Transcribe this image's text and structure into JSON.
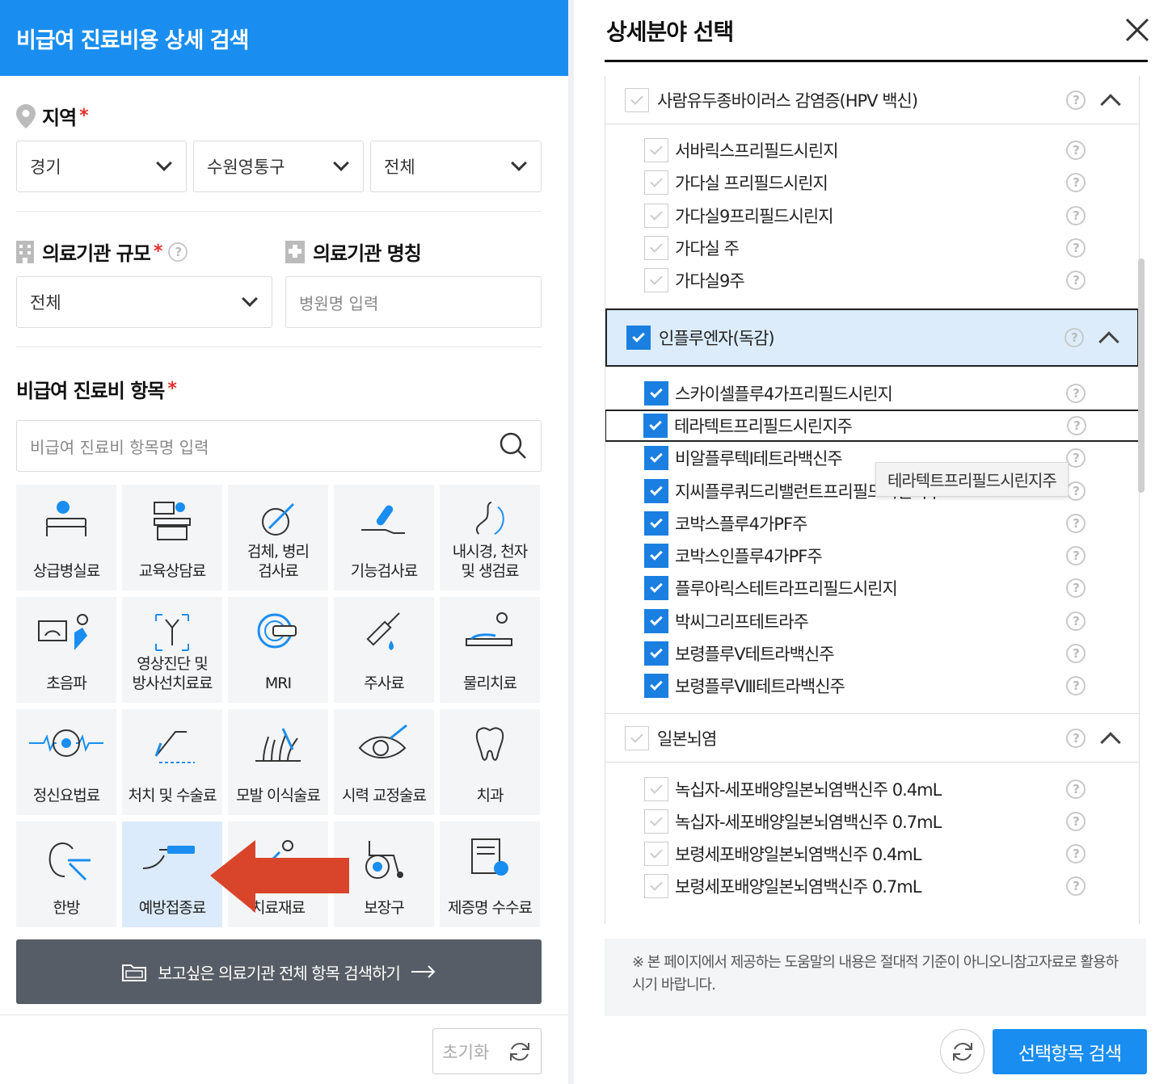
{
  "left": {
    "header_title": "비급여 진료비용 상세 검색",
    "region": {
      "label": "지역",
      "required": "*",
      "province": "경기",
      "district": "수원영통구",
      "town": "전체"
    },
    "facility_size": {
      "label": "의료기관 규모",
      "required": "*",
      "help": "?",
      "value": "전체"
    },
    "facility_name": {
      "label": "의료기관 명칭",
      "placeholder": "병원명 입력"
    },
    "items": {
      "label": "비급여 진료비 항목",
      "required": "*",
      "placeholder": "비급여 진료비 항목명 입력"
    },
    "tiles": [
      {
        "label": "상급병실료",
        "icon": "hospital-bed-icon"
      },
      {
        "label": "교육상담료",
        "icon": "counseling-icon"
      },
      {
        "label": "검체, 병리\n검사료",
        "icon": "pathology-icon"
      },
      {
        "label": "기능검사료",
        "icon": "function-test-icon"
      },
      {
        "label": "내시경, 천자\n및 생검료",
        "icon": "endoscope-icon"
      },
      {
        "label": "초음파",
        "icon": "ultrasound-icon"
      },
      {
        "label": "영상진단 및\n방사선치료료",
        "icon": "xray-icon"
      },
      {
        "label": "MRI",
        "icon": "mri-icon"
      },
      {
        "label": "주사료",
        "icon": "syringe-icon"
      },
      {
        "label": "물리치료",
        "icon": "physical-therapy-icon"
      },
      {
        "label": "정신요법료",
        "icon": "brain-icon"
      },
      {
        "label": "처치 및 수술료",
        "icon": "surgery-icon"
      },
      {
        "label": "모발 이식술료",
        "icon": "hair-icon"
      },
      {
        "label": "시력 교정술료",
        "icon": "eye-icon"
      },
      {
        "label": "치과",
        "icon": "tooth-icon"
      },
      {
        "label": "한방",
        "icon": "acupuncture-icon"
      },
      {
        "label": "예방접종료",
        "icon": "vaccine-icon"
      },
      {
        "label": "치료재료",
        "icon": "material-icon"
      },
      {
        "label": "보장구",
        "icon": "wheelchair-icon"
      },
      {
        "label": "제증명 수수료",
        "icon": "certificate-icon"
      }
    ],
    "search_all_button": "보고싶은 의료기관 전체 항목 검색하기",
    "reset_button": "초기화"
  },
  "right": {
    "title": "상세분야 선택",
    "categories": [
      {
        "label": "사람유두종바이러스 감염증(HPV 백신)",
        "checked": false,
        "items": [
          {
            "label": "서바릭스프리필드시린지",
            "checked": false
          },
          {
            "label": "가다실 프리필드시린지",
            "checked": false
          },
          {
            "label": "가다실9프리필드시린지",
            "checked": false
          },
          {
            "label": "가다실 주",
            "checked": false
          },
          {
            "label": "가다실9주",
            "checked": false
          }
        ]
      },
      {
        "label": "인플루엔자(독감)",
        "checked": true,
        "items": [
          {
            "label": "스카이셀플루4가프리필드시린지",
            "checked": true
          },
          {
            "label": "테라텍트프리필드시린지주",
            "checked": true
          },
          {
            "label": "비알플루텍I테트라백신주",
            "checked": true
          },
          {
            "label": "지씨플루쿼드리밸런트프리필드시린지주",
            "checked": true
          },
          {
            "label": "코박스플루4가PF주",
            "checked": true
          },
          {
            "label": "코박스인플루4가PF주",
            "checked": true
          },
          {
            "label": "플루아릭스테트라프리필드시린지",
            "checked": true
          },
          {
            "label": "박씨그리프테트라주",
            "checked": true
          },
          {
            "label": "보령플루Ⅴ테트라백신주",
            "checked": true
          },
          {
            "label": "보령플루Ⅷ테트라백신주",
            "checked": true
          }
        ]
      },
      {
        "label": "일본뇌염",
        "checked": false,
        "items": [
          {
            "label": "녹십자-세포배양일본뇌염백신주 0.4mL",
            "checked": false
          },
          {
            "label": "녹십자-세포배양일본뇌염백신주 0.7mL",
            "checked": false
          },
          {
            "label": "보령세포배양일본뇌염백신주 0.4mL",
            "checked": false
          },
          {
            "label": "보령세포배양일본뇌염백신주 0.7mL",
            "checked": false
          }
        ]
      }
    ],
    "tooltip": "테라텍트프리필드시린지주",
    "note": "※ 본 페이지에서 제공하는 도움말의 내용은 절대적 기준이 아니오니참고자료로 활용하시기 바랍니다.",
    "search_button": "선택항목 검색"
  },
  "colors": {
    "primary": "#1a8ef0",
    "dark_button": "#575d66",
    "required": "#e5302b",
    "arrow": "#d9452b"
  }
}
